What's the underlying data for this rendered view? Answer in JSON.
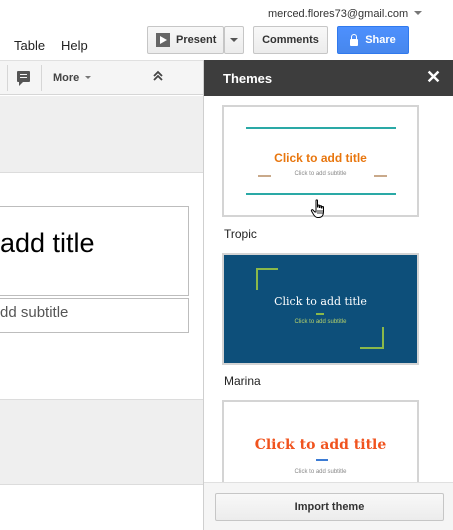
{
  "account": {
    "email": "merced.flores73@gmail.com"
  },
  "menu": {
    "table": "Table",
    "help": "Help"
  },
  "header_buttons": {
    "present": "Present",
    "comments": "Comments",
    "share": "Share"
  },
  "toolbar": {
    "more": "More"
  },
  "slide": {
    "title": "add title",
    "subtitle": "dd subtitle"
  },
  "themes_panel": {
    "title": "Themes",
    "themes": [
      {
        "name": "Tropic",
        "title": "Click to add title",
        "subtitle": "Click to add subtitle",
        "accent": "#e8760e",
        "line_color": "#2aa9a6"
      },
      {
        "name": "Marina",
        "title": "Click to add title",
        "subtitle": "Click to add subtitle",
        "background": "#0d4f7a",
        "accent": "#8ab84a"
      },
      {
        "name": "",
        "title": "Click to add title",
        "subtitle": "Click to add subtitle",
        "accent": "#f0531e"
      }
    ],
    "import_label": "Import theme"
  },
  "icons": [
    "play-icon",
    "caret-down-icon",
    "lock-icon",
    "comment-icon",
    "collapse-icon",
    "close-icon",
    "hand-cursor-icon"
  ]
}
